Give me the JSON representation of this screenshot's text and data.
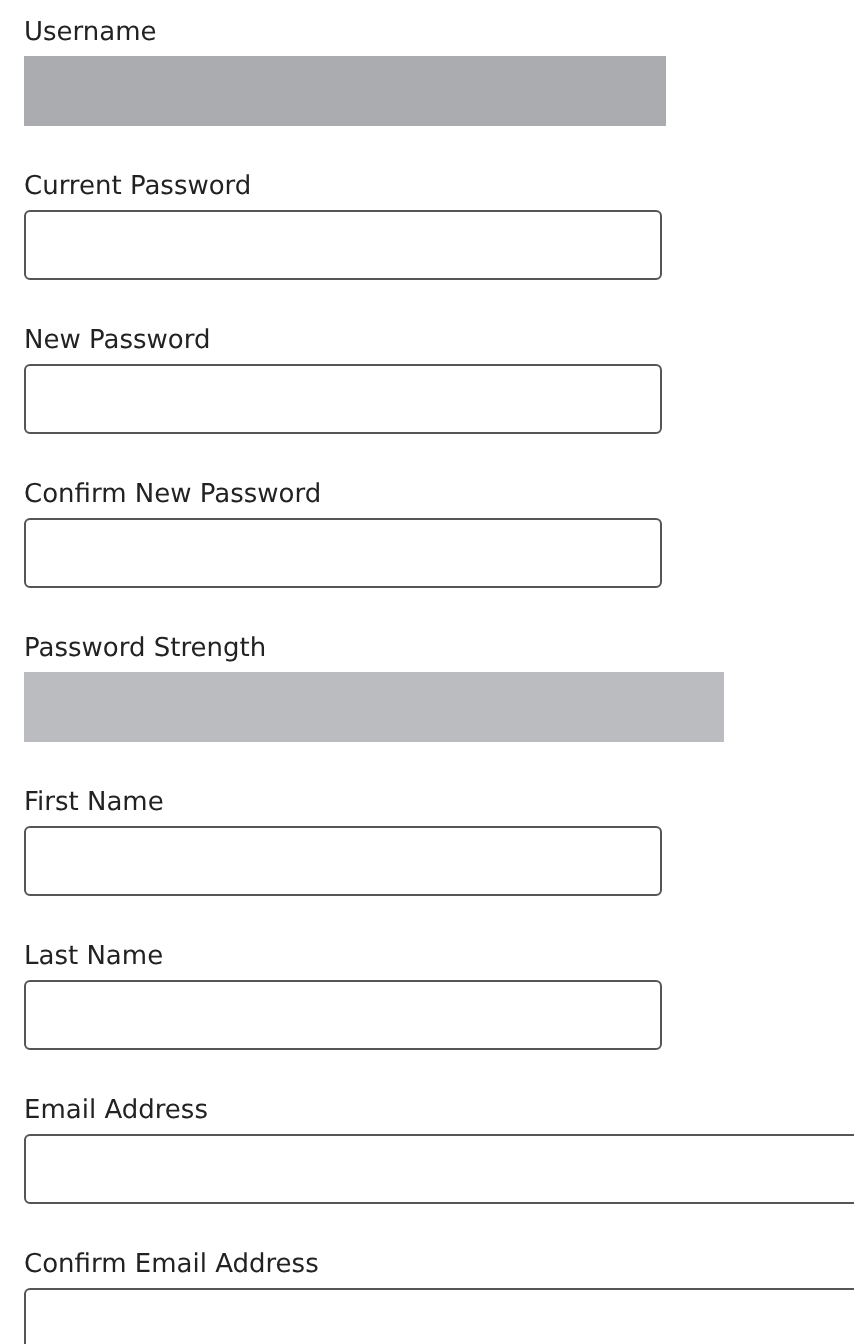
{
  "fields": [
    {
      "label": "Username",
      "kind": "text",
      "disabled": true
    },
    {
      "label": "Current Password",
      "kind": "password",
      "disabled": false
    },
    {
      "label": "New Password",
      "kind": "password",
      "disabled": false
    },
    {
      "label": "Confirm New Password",
      "kind": "password",
      "disabled": false
    },
    {
      "label": "Password Strength",
      "kind": "meter",
      "level": 0
    },
    {
      "label": "First Name",
      "kind": "text",
      "disabled": false
    },
    {
      "label": "Last Name",
      "kind": "text",
      "disabled": false
    },
    {
      "label": "Email Address",
      "kind": "email",
      "disabled": false
    },
    {
      "label": "Confirm Email Address",
      "kind": "email",
      "disabled": false
    }
  ]
}
